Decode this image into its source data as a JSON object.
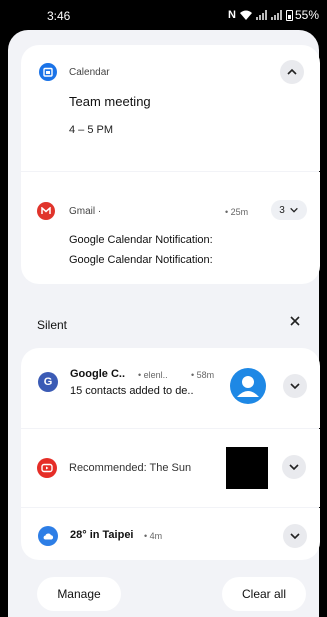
{
  "status_bar": {
    "time": "3:46",
    "battery": "55%"
  },
  "calendar": {
    "app_name": "Calendar",
    "title": "Team meeting",
    "time_range": "4 – 5 PM"
  },
  "gmail": {
    "app_name": "Gmail",
    "app_name_suffix": "·",
    "age": "• 25m",
    "count": "3",
    "lines": [
      "Google Calendar Notification:",
      "Google Calendar Notification:"
    ]
  },
  "silent": {
    "label": "Silent"
  },
  "google_contacts": {
    "title": "Google C..",
    "account": "• elenl..",
    "age": "• 58m",
    "body": "15 contacts added to de.."
  },
  "youtube": {
    "body": "Recommended: The Sun"
  },
  "weather": {
    "title": "28° in Taipei",
    "age": "• 4m"
  },
  "actions": {
    "manage": "Manage",
    "clear_all": "Clear all"
  },
  "colors": {
    "calendar_blue": "#1a73e8",
    "gmail_red": "#e0342b",
    "google_blue": "#3b5bb5",
    "youtube_red": "#e52d27",
    "weather_blue": "#2d7ee6",
    "avatar_blue": "#1e88e5"
  }
}
